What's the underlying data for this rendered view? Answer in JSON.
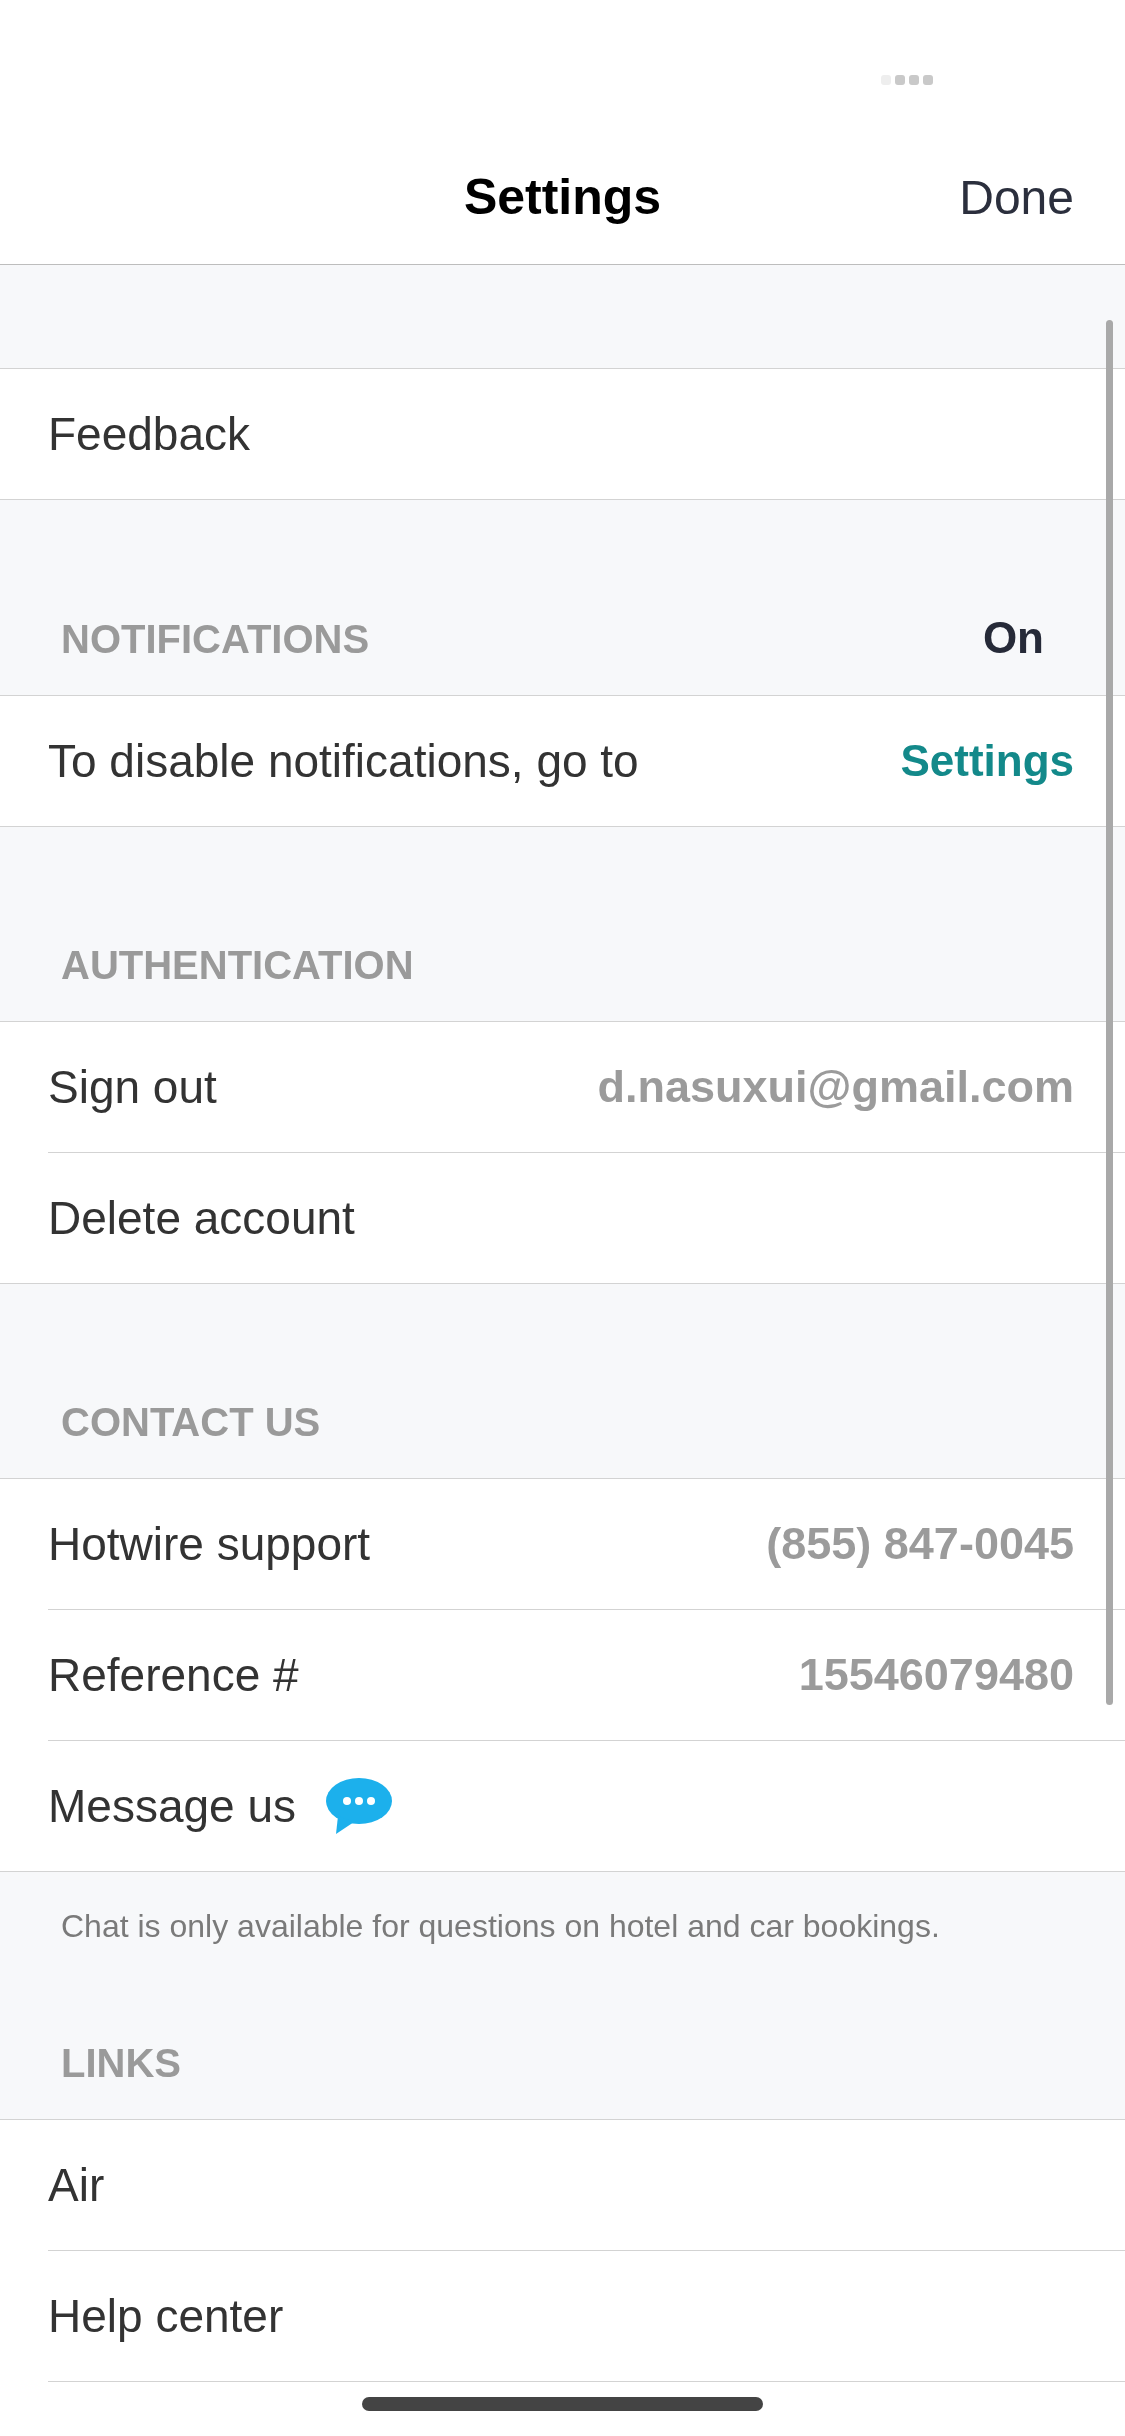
{
  "nav": {
    "title": "Settings",
    "done": "Done"
  },
  "sections": [
    {
      "rows": [
        {
          "kind": "plain",
          "label": "Feedback"
        }
      ]
    },
    {
      "header": "NOTIFICATIONS",
      "status": "On",
      "rows": [
        {
          "kind": "link",
          "label": "To disable notifications, go to",
          "link": "Settings"
        }
      ]
    },
    {
      "header": "AUTHENTICATION",
      "rows": [
        {
          "kind": "value",
          "label": "Sign out",
          "value": "d.nasuxui@gmail.com"
        },
        {
          "kind": "plain",
          "label": "Delete account"
        }
      ]
    },
    {
      "header": "CONTACT US",
      "rows": [
        {
          "kind": "value",
          "label": "Hotwire support",
          "value": "(855) 847-0045"
        },
        {
          "kind": "value",
          "label": "Reference #",
          "value": "15546079480"
        },
        {
          "kind": "chat",
          "label": "Message us"
        }
      ],
      "footer": "Chat is only available for questions on hotel and car bookings."
    },
    {
      "header": "LINKS",
      "rows": [
        {
          "kind": "plain",
          "label": "Air"
        },
        {
          "kind": "plain",
          "label": "Help center"
        }
      ]
    }
  ]
}
